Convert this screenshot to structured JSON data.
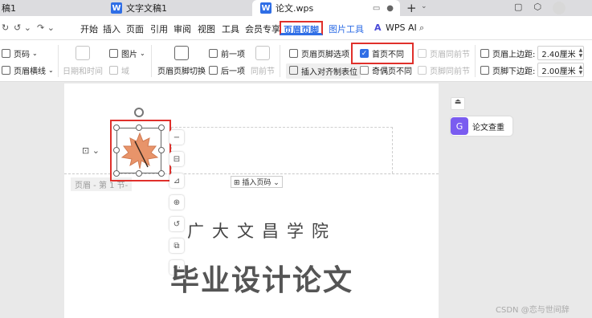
{
  "tabs": [
    {
      "label": "稿1",
      "icon": "doc-icon"
    },
    {
      "label": "文字文稿1",
      "icon": "wps-writer-icon"
    },
    {
      "label": "论文.wps",
      "icon": "wps-writer-icon",
      "active": true
    }
  ],
  "menu": {
    "items": [
      "开始",
      "插入",
      "页面",
      "引用",
      "审阅",
      "视图",
      "工具",
      "会员专享"
    ],
    "active": "页眉页脚",
    "extra": "图片工具",
    "ai": "WPS AI"
  },
  "ribbon": {
    "page_number": "页码",
    "header_line": "页眉横线",
    "date_time": "日期和时间",
    "picture": "图片",
    "field": "域",
    "switch": "页眉页脚切换",
    "prev": "前一项",
    "next": "后一项",
    "same_as_prev": "同前节",
    "options": "页眉页脚选项",
    "insert_align": "插入对齐制表位",
    "first_page_diff": "首页不同",
    "odd_even_diff": "奇偶页不同",
    "header_same_prev": "页眉同前节",
    "footer_same_prev": "页脚同前节",
    "header_top_label": "页眉上边距:",
    "header_top_value": "2.40厘米",
    "footer_bottom_label": "页脚下边距:",
    "footer_bottom_value": "2.00厘米"
  },
  "document": {
    "header_label": "页眉 - 第 1 节-",
    "insert_page_number": "插入页码",
    "school": "广大文昌学院",
    "thesis_title": "毕业设计论文"
  },
  "side": {
    "plagiarism": "论文查重"
  },
  "watermark": "CSDN @恋与世间辞",
  "colors": {
    "accent": "#2f6ee6",
    "highlight": "#e0302b",
    "leaf": "#e8946a"
  }
}
